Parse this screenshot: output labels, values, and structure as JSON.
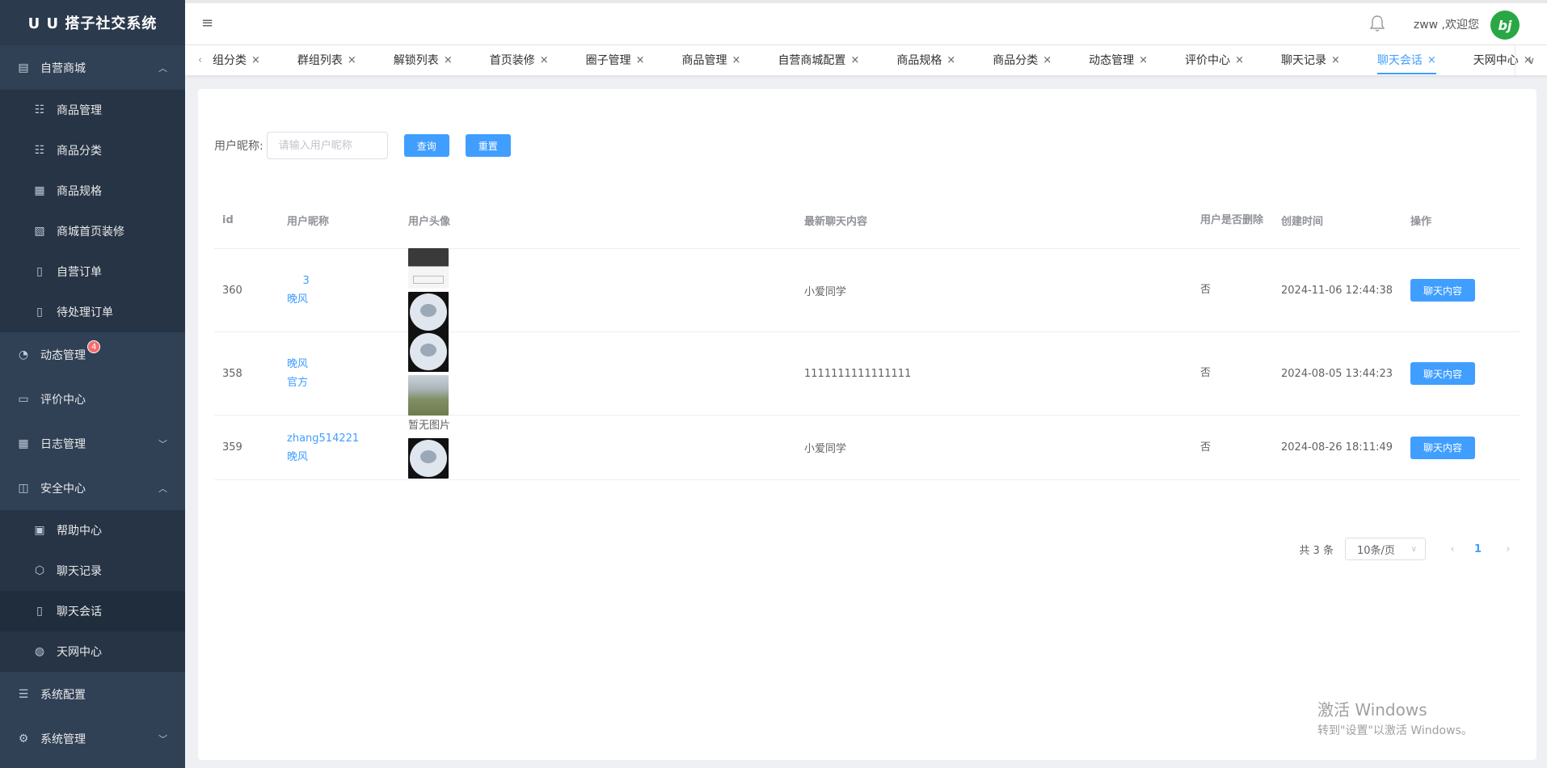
{
  "brand": "U U 搭子社交系统",
  "sidebar": {
    "groups": [
      {
        "label": "自营商城",
        "icon": "shop-icon",
        "arrow": "^",
        "children": [
          {
            "label": "商品管理",
            "icon": "list-icon"
          },
          {
            "label": "商品分类",
            "icon": "list-icon"
          },
          {
            "label": "商品规格",
            "icon": "grid-icon"
          },
          {
            "label": "商城首页装修",
            "icon": "document-edit-icon"
          },
          {
            "label": "自营订单",
            "icon": "clipboard-icon"
          },
          {
            "label": "待处理订单",
            "icon": "document-icon"
          }
        ]
      },
      {
        "label": "动态管理",
        "icon": "pie-chart-icon",
        "badge": "4"
      },
      {
        "label": "评价中心",
        "icon": "comment-icon"
      },
      {
        "label": "日志管理",
        "icon": "grid-icon",
        "arrow": "v"
      },
      {
        "label": "安全中心",
        "icon": "inbox-icon",
        "arrow": "^",
        "children": [
          {
            "label": "帮助中心",
            "icon": "id-card-icon"
          },
          {
            "label": "聊天记录",
            "icon": "box-icon"
          },
          {
            "label": "聊天会话",
            "icon": "clipboard-icon",
            "active": true
          },
          {
            "label": "天网中心",
            "icon": "globe-icon"
          }
        ]
      },
      {
        "label": "系统配置",
        "icon": "menu-list-icon"
      },
      {
        "label": "系统管理",
        "icon": "gear-icon",
        "arrow": "v"
      }
    ]
  },
  "header": {
    "welcome": "zww ,欢迎您",
    "avatar_text": "bj"
  },
  "tabs": {
    "items": [
      "组分类",
      "群组列表",
      "解锁列表",
      "首页装修",
      "圈子管理",
      "商品管理",
      "自营商城配置",
      "商品规格",
      "商品分类",
      "动态管理",
      "评价中心",
      "聊天记录",
      "聊天会话",
      "天网中心"
    ],
    "active": "聊天会话"
  },
  "search": {
    "label": "用户昵称:",
    "placeholder": "请输入用户昵称",
    "query_label": "查询",
    "reset_label": "重置"
  },
  "table": {
    "headers": {
      "id": "id",
      "nick": "用户昵称",
      "avatar": "用户头像",
      "msg": "最新聊天内容",
      "deleted": "用户是否删除",
      "time": "创建时间",
      "op": "操作"
    },
    "rows": [
      {
        "id": "360",
        "nick1": "   3",
        "nick2": "晚风",
        "avatars": [
          "screen",
          "cat"
        ],
        "no_img": "",
        "msg": "小爱同学",
        "deleted": "否",
        "time": "2024-11-06 12:44:38",
        "op": "聊天内容"
      },
      {
        "id": "358",
        "nick1": "晚风",
        "nick2": "官方",
        "avatars": [
          "cat",
          "mountain"
        ],
        "no_img": "",
        "msg": "1111111111111111",
        "deleted": "否",
        "time": "2024-08-05 13:44:23",
        "op": "聊天内容"
      },
      {
        "id": "359",
        "nick1": "zhang514221",
        "nick2": "晚风",
        "avatars": [
          "cat"
        ],
        "no_img": "暂无图片",
        "msg": "小爱同学",
        "deleted": "否",
        "time": "2024-08-26 18:11:49",
        "op": "聊天内容"
      }
    ]
  },
  "pager": {
    "total": "共 3 条",
    "size": "10条/页",
    "page": "1"
  },
  "watermark": {
    "line1": "激活 Windows",
    "line2": "转到\"设置\"以激活 Windows。"
  },
  "colors": {
    "sidebar_bg": "#304156",
    "primary": "#409eff",
    "badge": "#f56c6c",
    "avatar": "#29a745"
  }
}
